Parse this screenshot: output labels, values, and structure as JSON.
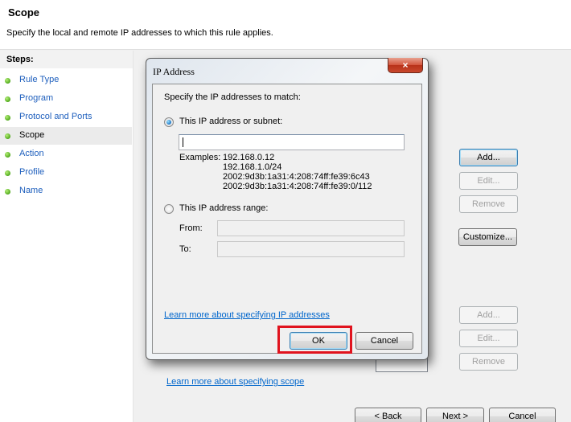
{
  "header": {
    "title": "Scope",
    "subtitle": "Specify the local and remote IP addresses to which this rule applies."
  },
  "steps": {
    "title": "Steps:",
    "items": [
      {
        "label": "Rule Type",
        "current": false
      },
      {
        "label": "Program",
        "current": false
      },
      {
        "label": "Protocol and Ports",
        "current": false
      },
      {
        "label": "Scope",
        "current": true
      },
      {
        "label": "Action",
        "current": false
      },
      {
        "label": "Profile",
        "current": false
      },
      {
        "label": "Name",
        "current": false
      }
    ]
  },
  "main": {
    "local": {
      "add": "Add...",
      "edit": "Edit...",
      "remove": "Remove"
    },
    "customize": "Customize...",
    "remote": {
      "add": "Add...",
      "edit": "Edit...",
      "remove": "Remove"
    },
    "learn_more": "Learn more about specifying scope",
    "nav": {
      "back": "< Back",
      "next": "Next >",
      "cancel": "Cancel"
    }
  },
  "dialog": {
    "title": "IP Address",
    "close_icon": "×",
    "prompt": "Specify the IP addresses to match:",
    "option_subnet": {
      "label": "This IP address or subnet:",
      "selected": true,
      "value": ""
    },
    "examples_label": "Examples:",
    "examples": [
      "192.168.0.12",
      "192.168.1.0/24",
      "2002:9d3b:1a31:4:208:74ff:fe39:6c43",
      "2002:9d3b:1a31:4:208:74ff:fe39:0/112"
    ],
    "option_range": {
      "label": "This IP address range:",
      "selected": false
    },
    "from_label": "From:",
    "to_label": "To:",
    "from_value": "",
    "to_value": "",
    "learn_more": "Learn more about specifying IP addresses",
    "ok": "OK",
    "cancel": "Cancel"
  },
  "colors": {
    "link": "#0066cc",
    "highlight": "#e0131e",
    "step_dot": "#4fa81a"
  }
}
